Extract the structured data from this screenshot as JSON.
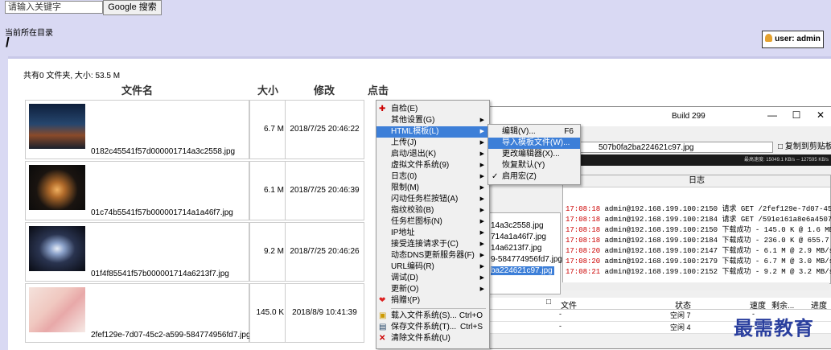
{
  "search": {
    "placeholder": "请输入关键字",
    "button": "Google 搜索"
  },
  "directory": {
    "label": "当前所在目录",
    "path": "/"
  },
  "user": {
    "label": "user: admin"
  },
  "summary": "共有0 文件夹, 大小: 53.5 M",
  "table": {
    "headers": [
      "文件名",
      "大小",
      "修改",
      "点击"
    ],
    "rows": [
      {
        "name": "0182c45541f57d000001714a3c2558.jpg",
        "size": "6.7 M",
        "date": "2018/7/25 20:46:22"
      },
      {
        "name": "01c74b5541f57b000001714a1a46f7.jpg",
        "size": "6.1 M",
        "date": "2018/7/25 20:46:39"
      },
      {
        "name": "01f4f85541f57b000001714a6213f7.jpg",
        "size": "9.2 M",
        "date": "2018/7/25 20:46:26"
      },
      {
        "name": "2fef129e-7d07-45c2-a599-584774956fd7.jpg",
        "size": "145.0 K",
        "date": "2018/8/9 10:41:39"
      }
    ]
  },
  "context_menu": {
    "items": [
      {
        "label": "自检(E)",
        "arrow": false
      },
      {
        "label": "其他设置(G)",
        "arrow": true
      },
      {
        "label": "HTML模板(L)",
        "arrow": true
      },
      {
        "label": "上传(J)",
        "arrow": true
      },
      {
        "label": "启动/退出(K)",
        "arrow": true
      },
      {
        "label": "虚拟文件系统(9)",
        "arrow": true
      },
      {
        "label": "日志(0)",
        "arrow": true
      },
      {
        "label": "限制(M)",
        "arrow": true
      },
      {
        "label": "闪动任务栏按钮(A)",
        "arrow": true
      },
      {
        "label": "指纹校验(B)",
        "arrow": true
      },
      {
        "label": "任务栏图标(N)",
        "arrow": true
      },
      {
        "label": "IP地址",
        "arrow": true
      },
      {
        "label": "接受连接请求于(C)",
        "arrow": true
      },
      {
        "label": "动态DNS更新服务器(F)",
        "arrow": true
      },
      {
        "label": "URL编码(R)",
        "arrow": true
      },
      {
        "label": "调试(D)",
        "arrow": true
      },
      {
        "label": "更新(O)",
        "arrow": true
      },
      {
        "label": "捐赠!(P)",
        "arrow": false
      },
      {
        "label": "载入文件系统(S)...",
        "shortcut": "Ctrl+O"
      },
      {
        "label": "保存文件系统(T)...",
        "shortcut": "Ctrl+S"
      },
      {
        "label": "清除文件系统(U)",
        "shortcut": ""
      }
    ]
  },
  "submenu": {
    "items": [
      {
        "label": "编辑(V)...",
        "shortcut": "F6"
      },
      {
        "label": "导入模板文件(W)...",
        "shortcut": ""
      },
      {
        "label": "更改编辑器(X)...",
        "shortcut": ""
      },
      {
        "label": "恢复默认(Y)",
        "shortcut": ""
      },
      {
        "label": "启用宏(Z)",
        "shortcut": ""
      }
    ]
  },
  "app": {
    "title": "Build 299",
    "url": "507b0fa2ba224621c97.jpg",
    "copy_button": "复制到剪贴板",
    "speed": "最高速度: 15049.1 KB/s -- 127595 KB/s",
    "log_header": "日志",
    "files": [
      "14a3c2558.jpg",
      "714a1a46f7.jpg",
      "14a6213f7.jpg",
      "9-584774956fd7.jpg",
      "ba224621c97.jpg"
    ],
    "log": [
      {
        "time": "17:08:18",
        "text": "admin@192.168.199.100:2150 请求 GET /2fef129e-7d07-45c2"
      },
      {
        "time": "17:08:18",
        "text": "admin@192.168.199.100:2184 请求 GET /591e161a8e6a4507b0"
      },
      {
        "time": "17:08:18",
        "text": "admin@192.168.199.100:2150 下载成功 - 145.0 K @ 1.6 MB/"
      },
      {
        "time": "17:08:18",
        "text": "admin@192.168.199.100:2184 下载成功 - 236.0 K @ 655.7 K"
      },
      {
        "time": "17:08:20",
        "text": "admin@192.168.199.100:2147 下载成功 - 6.1 M @ 2.9 MB/s"
      },
      {
        "time": "17:08:20",
        "text": "admin@192.168.199.100:2179 下载成功 - 6.7 M @ 3.0 MB/s"
      },
      {
        "time": "17:08:21",
        "text": "admin@192.168.199.100:2152 下载成功 - 9.2 M @ 3.2 MB/s"
      }
    ],
    "table_headers": [
      "文件",
      "状态",
      "速度",
      "剩余...",
      "进度"
    ],
    "table_rows": [
      {
        "dash": "-",
        "status": "空闲 7",
        "speed": "-"
      },
      {
        "dash": "-",
        "status": "空闲 4",
        "speed": "-"
      }
    ]
  },
  "watermark": "最需教育",
  "colors": {
    "highlight": "#3d7fd8",
    "page_bg": "#d9d9f3",
    "log_time": "#cc0000"
  }
}
